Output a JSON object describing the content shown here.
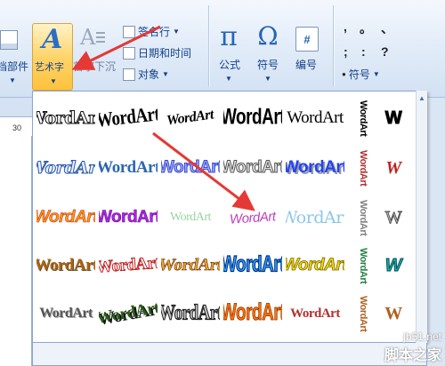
{
  "ribbon": {
    "parts_label": "档部件",
    "wordart_label": "艺术字",
    "dropcap_label": "首字下沉",
    "signature_label": "签名行",
    "datetime_label": "日期和时间",
    "object_label": "对象",
    "formula_label": "公式",
    "symbol_label": "符号",
    "number_label": "编号",
    "number_icon": "#",
    "punct_symbol_label": "符号",
    "punct_row1": [
      ",",
      "。",
      "、"
    ],
    "punct_row2": [
      ";",
      ":",
      "?"
    ],
    "punct_bullet": "●"
  },
  "ruler": {
    "number": "30"
  },
  "gallery": {
    "items": [
      {
        "text": "WordArt",
        "style": "s1"
      },
      {
        "text": "WordArt",
        "style": "s2"
      },
      {
        "text": "WordArt",
        "style": "s3"
      },
      {
        "text": "WordArt",
        "style": "s4"
      },
      {
        "text": "WordArt",
        "style": "s5"
      },
      {
        "text": "WordArt",
        "style": "s6"
      },
      {
        "text": "WordArt",
        "style": "s7"
      },
      {
        "text": "WordArt",
        "style": "s8"
      },
      {
        "text": "WordArt",
        "style": "s9"
      },
      {
        "text": "WordArt",
        "style": "s10"
      },
      {
        "text": "WordArt",
        "style": "s11"
      },
      {
        "text": "WordArt",
        "style": "s12"
      },
      {
        "text": "WordArt",
        "style": "s13"
      },
      {
        "text": "WordArt",
        "style": "s14"
      },
      {
        "text": "WordArt",
        "style": "s15"
      },
      {
        "text": "WordArt",
        "style": "s16"
      },
      {
        "text": "WordArt",
        "style": "s17"
      },
      {
        "text": "WordArt",
        "style": "s18"
      },
      {
        "text": "WordArt",
        "style": "s19"
      },
      {
        "text": "WordArt",
        "style": "s20"
      },
      {
        "text": "WordArt",
        "style": "s21"
      },
      {
        "text": "WordArt",
        "style": "s22"
      },
      {
        "text": "WordArt",
        "style": "s23"
      },
      {
        "text": "WordArt",
        "style": "s24"
      },
      {
        "text": "WordArt",
        "style": "s25"
      }
    ],
    "vertical_items": [
      "WordArt",
      "WordArt",
      "WordArt",
      "WordArt",
      "WordArt"
    ],
    "w_items": [
      "W",
      "W",
      "W",
      "W",
      "W"
    ]
  },
  "watermark": {
    "site": "jb51.net",
    "name": "脚本之家"
  },
  "colors": {
    "accent": "#e53935",
    "wordart_button_bg": "#ffd46a",
    "ribbon_text": "#15428b"
  }
}
